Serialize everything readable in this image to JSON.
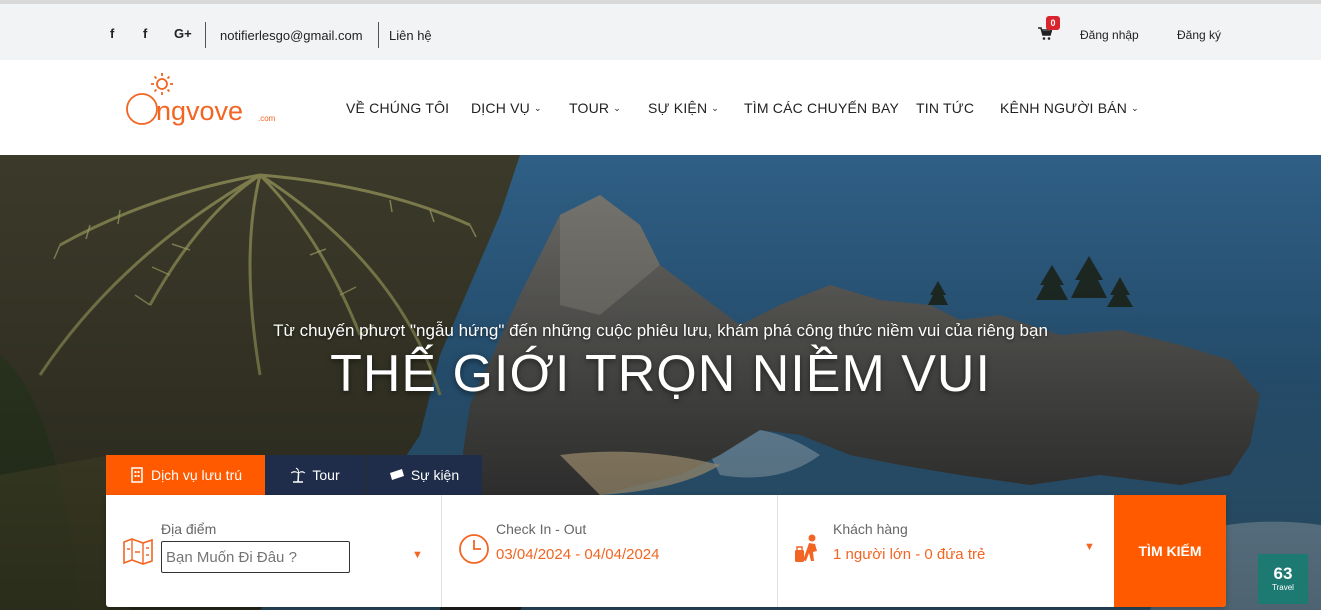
{
  "topbar": {
    "social": [
      "f",
      "f",
      "G+"
    ],
    "email": "notifierlesgo@gmail.com",
    "contact": "Liên hệ",
    "cart_count": "0",
    "login": "Đăng nhập",
    "register": "Đăng ký"
  },
  "logo": {
    "main": "ngvove",
    "suffix": ".com"
  },
  "nav": {
    "items": [
      {
        "label": "VỀ CHÚNG TÔI"
      },
      {
        "label": "DỊCH VỤ"
      },
      {
        "label": "TOUR"
      },
      {
        "label": "SỰ KIỆN"
      },
      {
        "label": "TÌM CÁC CHUYẾN BAY"
      },
      {
        "label": "TIN TỨC"
      },
      {
        "label": "KÊNH NGƯỜI BÁN"
      }
    ]
  },
  "hero": {
    "subtitle": "Từ chuyến phượt \"ngẫu hứng\" đến những cuộc phiêu lưu, khám phá công thức niềm vui của riêng bạn",
    "title": "THẾ GIỚI TRỌN NIỀM VUI"
  },
  "tabs": [
    {
      "label": "Dịch vụ lưu trú",
      "color": "#ff5a00"
    },
    {
      "label": "Tour",
      "color": "#1f2d4a"
    },
    {
      "label": "Sự kiện",
      "color": "#1f2d4a"
    }
  ],
  "search": {
    "location_label": "Địa điểm",
    "location_placeholder": "Bạn Muốn Đi Đâu ?",
    "checkin_label": "Check In - Out",
    "checkin_value": "03/04/2024 - 04/04/2024",
    "guests_label": "Khách hàng",
    "guests_value": "1 người lớn - 0 đứa trẻ",
    "button": "TÌM KIẾM"
  },
  "badge": {
    "line1": "63",
    "line2": "Travel"
  },
  "colors": {
    "accent": "#ff5a00",
    "navy": "#1f2d4a",
    "orange_text": "#f26522"
  }
}
